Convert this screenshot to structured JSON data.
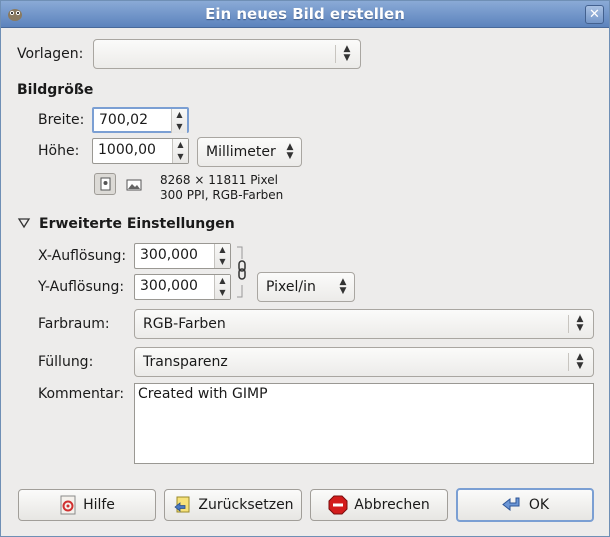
{
  "window": {
    "title": "Ein neues Bild erstellen"
  },
  "templates": {
    "label": "Vorlagen:",
    "value": ""
  },
  "image_size": {
    "heading": "Bildgröße",
    "width_label": "Breite:",
    "width_value": "700,02",
    "height_label": "Höhe:",
    "height_value": "1000,00",
    "unit": "Millimeter",
    "info_line1": "8268 × 11811 Pixel",
    "info_line2": "300 PPI, RGB-Farben"
  },
  "advanced": {
    "heading": "Erweiterte Einstellungen",
    "x_res_label": "X-Auflösung:",
    "x_res_value": "300,000",
    "y_res_label": "Y-Auflösung:",
    "y_res_value": "300,000",
    "res_unit": "Pixel/in",
    "colorspace_label": "Farbraum:",
    "colorspace_value": "RGB-Farben",
    "fill_label": "Füllung:",
    "fill_value": "Transparenz",
    "comment_label": "Kommentar:",
    "comment_value": "Created with GIMP"
  },
  "buttons": {
    "help": "Hilfe",
    "reset": "Zurücksetzen",
    "cancel": "Abbrechen",
    "ok": "OK"
  },
  "colors": {
    "titlebar": "#6f93c9",
    "focus": "#7b9fd3",
    "cancel_icon": "#d31c1c"
  },
  "icons": [
    "gimp-icon",
    "close-icon",
    "portrait-icon",
    "landscape-icon",
    "chain-icon",
    "help-icon",
    "reset-icon",
    "stop-icon",
    "ok-arrow-icon",
    "expander-down-icon"
  ]
}
